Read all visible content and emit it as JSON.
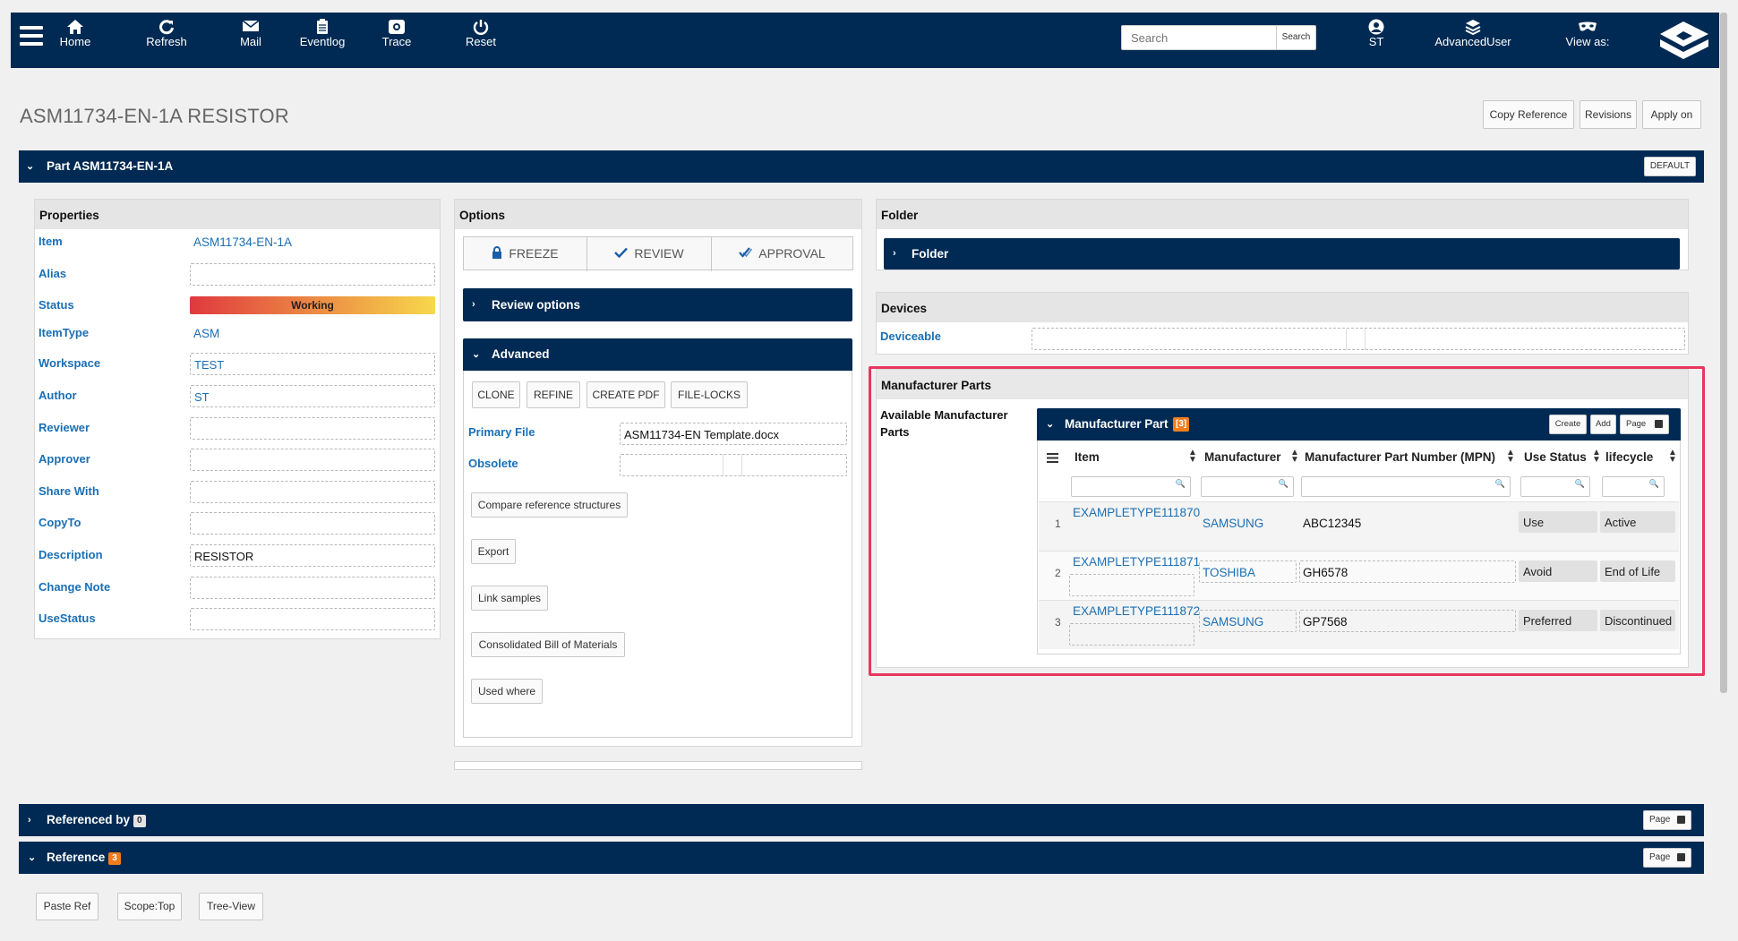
{
  "nav": {
    "items": [
      {
        "label": "Home",
        "icon": "home-icon"
      },
      {
        "label": "Refresh",
        "icon": "refresh-icon"
      },
      {
        "label": "Mail",
        "icon": "mail-icon"
      },
      {
        "label": "Eventlog",
        "icon": "eventlog-icon"
      },
      {
        "label": "Trace",
        "icon": "trace-icon"
      },
      {
        "label": "Reset",
        "icon": "power-icon"
      }
    ],
    "search_placeholder": "Search",
    "search_button": "Search",
    "user": "ST",
    "role": "AdvancedUser",
    "view_as": "View as:"
  },
  "page": {
    "title": "ASM11734-EN-1A RESISTOR",
    "actions": [
      "Copy Reference",
      "Revisions",
      "Apply on"
    ]
  },
  "part_bar": {
    "label": "Part ASM11734-EN-1A",
    "default_btn": "DEFAULT"
  },
  "properties": {
    "header": "Properties",
    "rows": [
      {
        "label": "Item",
        "value": "ASM11734-EN-1A"
      },
      {
        "label": "Alias",
        "value": ""
      },
      {
        "label": "Status",
        "value": "Working"
      },
      {
        "label": "ItemType",
        "value": "ASM"
      },
      {
        "label": "Workspace",
        "value": "TEST"
      },
      {
        "label": "Author",
        "value": "ST"
      },
      {
        "label": "Reviewer",
        "value": ""
      },
      {
        "label": "Approver",
        "value": ""
      },
      {
        "label": "Share With",
        "value": ""
      },
      {
        "label": "CopyTo",
        "value": ""
      },
      {
        "label": "Description",
        "value": "RESISTOR"
      },
      {
        "label": "Change Note",
        "value": ""
      },
      {
        "label": "UseStatus",
        "value": ""
      }
    ]
  },
  "options": {
    "header": "Options",
    "tabs": [
      "FREEZE",
      "REVIEW",
      "APPROVAL"
    ],
    "review_options": "Review options",
    "advanced": "Advanced",
    "adv_buttons": [
      "CLONE",
      "REFINE",
      "CREATE PDF",
      "FILE-LOCKS"
    ],
    "primary_file_label": "Primary File",
    "primary_file": "ASM11734-EN Template.docx",
    "obsolete_label": "Obsolete",
    "actions": [
      "Compare reference structures",
      "Export",
      "Link samples",
      "Consolidated Bill of Materials",
      "Used where"
    ]
  },
  "folder": {
    "header": "Folder",
    "bar": "Folder"
  },
  "devices": {
    "header": "Devices",
    "deviceable": "Deviceable"
  },
  "mfr": {
    "header": "Manufacturer Parts",
    "available": "Available Manufacturer Parts",
    "grid_title": "Manufacturer Part",
    "grid_count": "[3]",
    "grid_buttons": [
      "Create",
      "Add",
      "Page"
    ],
    "columns": [
      "Item",
      "Manufacturer",
      "Manufacturer Part Number (MPN)",
      "Use Status",
      "lifecycle"
    ],
    "rows": [
      {
        "n": "1",
        "item": "EXAMPLETYPE111870",
        "manufacturer": "SAMSUNG",
        "mpn": "ABC12345",
        "use_status": "Use",
        "lifecycle": "Active"
      },
      {
        "n": "2",
        "item": "EXAMPLETYPE111871",
        "manufacturer": "TOSHIBA",
        "mpn": "GH6578",
        "use_status": "Avoid",
        "lifecycle": "End of Life"
      },
      {
        "n": "3",
        "item": "EXAMPLETYPE111872",
        "manufacturer": "SAMSUNG",
        "mpn": "GP7568",
        "use_status": "Preferred",
        "lifecycle": "Discontinued"
      }
    ]
  },
  "referenced_by": {
    "label": "Referenced by",
    "count": "0",
    "page": "Page"
  },
  "reference": {
    "label": "Reference",
    "count": "3",
    "page": "Page",
    "buttons": [
      "Paste Ref",
      "Scope:Top",
      "Tree-View"
    ]
  },
  "colors": {
    "nav": "#002a53",
    "link": "#1a6fb5",
    "highlight": "#e8365d",
    "badge": "#f07d1d"
  }
}
